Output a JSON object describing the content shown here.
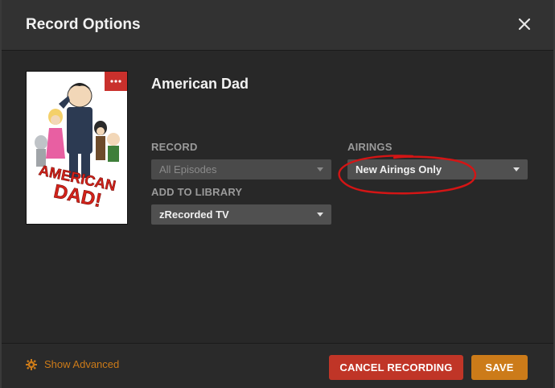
{
  "dialog": {
    "title": "Record Options",
    "close_icon": "close-icon"
  },
  "show": {
    "title": "American Dad",
    "poster_text": "AMERICAN DAD!",
    "poster_badge_icon": "more-icon"
  },
  "record": {
    "label": "RECORD",
    "value": "All Episodes",
    "disabled": true
  },
  "airings": {
    "label": "AIRINGS",
    "value": "New Airings Only"
  },
  "library": {
    "label": "ADD TO LIBRARY",
    "value": "zRecorded TV"
  },
  "footer": {
    "show_advanced": "Show Advanced",
    "show_advanced_icon": "gear-icon",
    "cancel_label": "CANCEL RECORDING",
    "save_label": "SAVE"
  },
  "colors": {
    "accent": "#cc7b19",
    "danger": "#c03527",
    "annotation": "#d41515"
  }
}
